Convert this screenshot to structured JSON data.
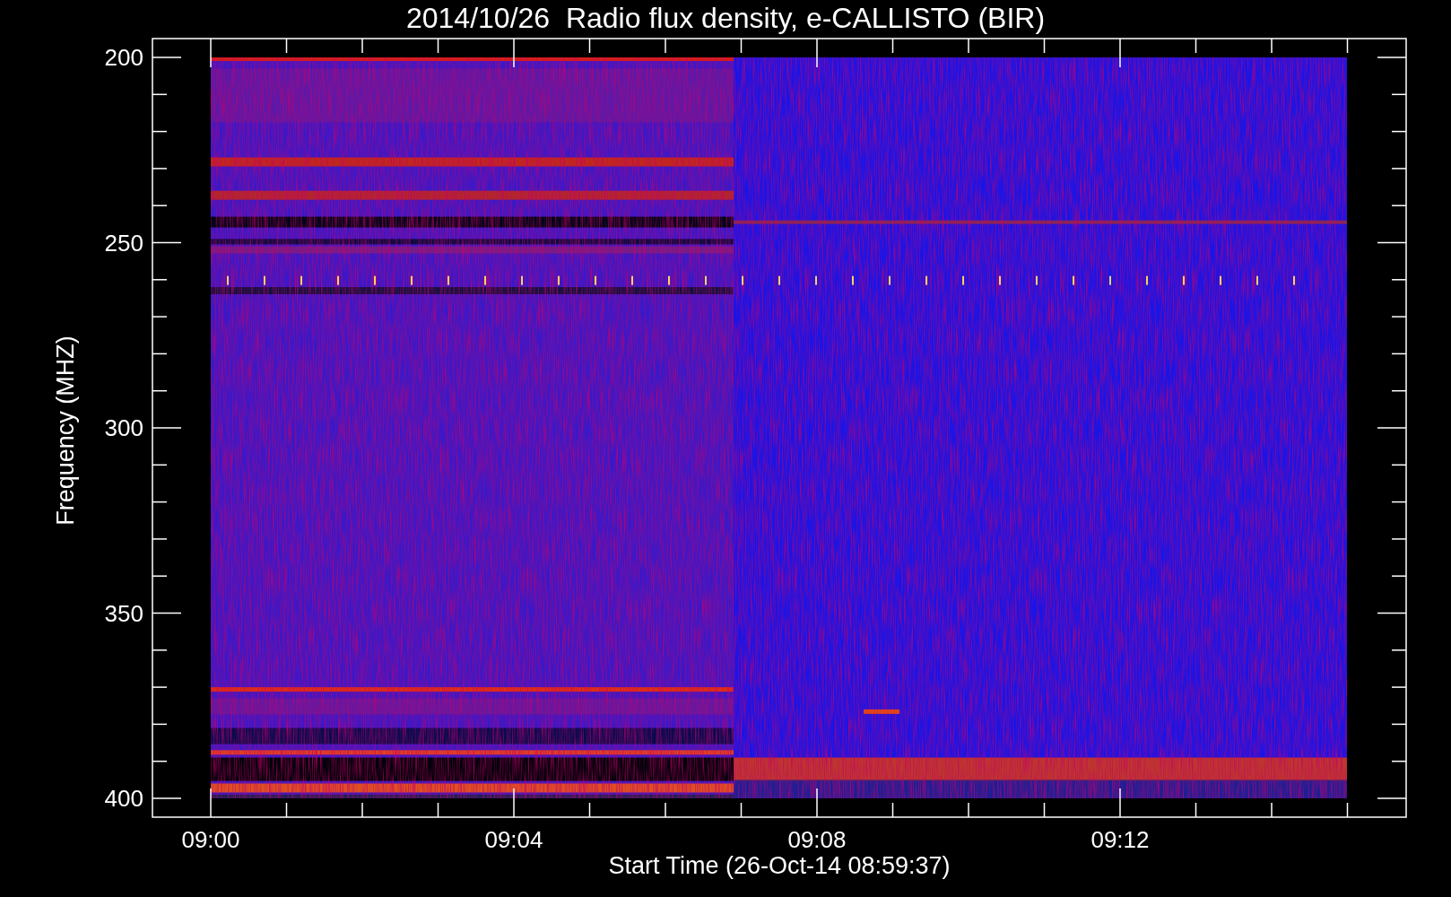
{
  "title": "2014/10/26  Radio flux density, e-CALLISTO (BIR)",
  "ylabel": "Frequency (MHZ)",
  "xlabel": "Start Time (26-Oct-14 08:59:37)",
  "yticks": [
    "200",
    "250",
    "300",
    "350",
    "400"
  ],
  "xticks": [
    "09:00",
    "09:04",
    "09:08",
    "09:12"
  ]
}
